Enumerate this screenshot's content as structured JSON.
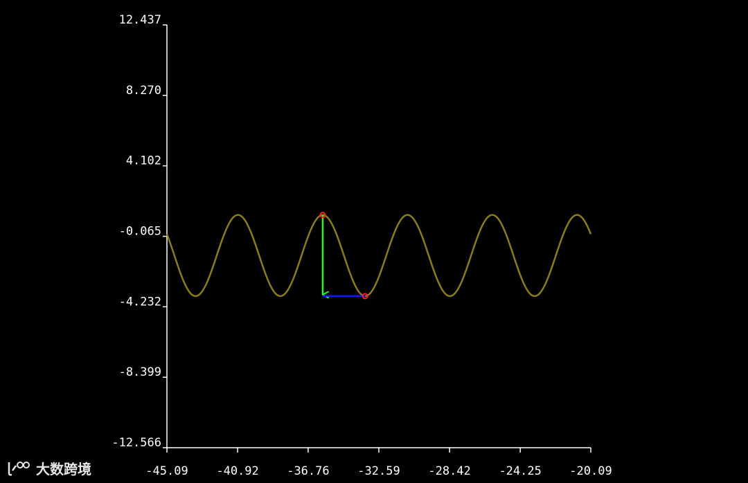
{
  "chart_data": {
    "type": "line",
    "title": "",
    "xlabel": "",
    "ylabel": "",
    "xlim": [
      -45.09,
      -20.09
    ],
    "ylim": [
      -12.566,
      12.437
    ],
    "x_ticks": [
      "-45.09",
      "-40.92",
      "-36.76",
      "-32.59",
      "-28.42",
      "-24.25",
      "-20.09"
    ],
    "y_ticks": [
      "12.437",
      "8.270",
      "4.102",
      "-0.065",
      "-4.232",
      "-8.399",
      "-12.566"
    ],
    "grid": false,
    "series": [
      {
        "type": "sine",
        "amplitude": 2.4,
        "offset": -1.2,
        "period": 5.0,
        "peak_x": -35.9,
        "color": "#8a7d1a"
      }
    ],
    "annotations": {
      "peak_point": {
        "x": -35.9,
        "y": 1.2
      },
      "trough_point": {
        "x": -33.4,
        "y": -3.6
      },
      "vertical_arrow_color": "#22ff22",
      "horizontal_arrow_color": "#1a1aff",
      "marker_color": "#ff2222"
    },
    "background": "#000000",
    "axis_color": "#ffffff"
  },
  "watermark": {
    "text": "大数跨境"
  }
}
